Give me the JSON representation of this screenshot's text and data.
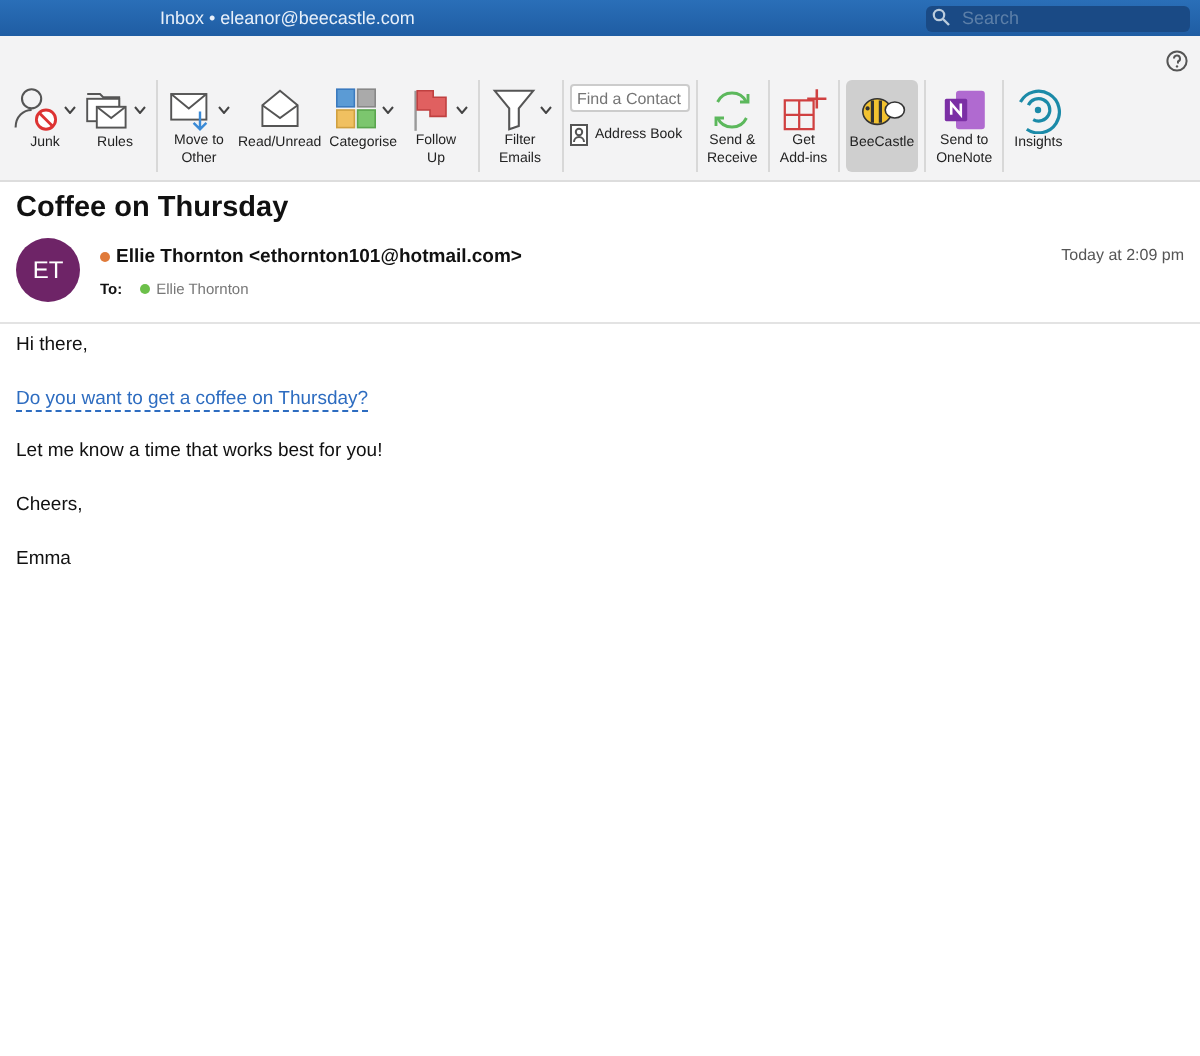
{
  "window": {
    "title": "Inbox • eleanor@beecastle.com",
    "search": {
      "placeholder": "Search"
    }
  },
  "ribbon": {
    "groups": [
      {
        "buttons": [
          {
            "label": "Junk",
            "dropdown": true,
            "selected": false
          },
          {
            "label": "Rules",
            "dropdown": true,
            "selected": false
          }
        ]
      },
      {
        "buttons": [
          {
            "label": "Move to\nOther",
            "dropdown": true,
            "selected": false
          },
          {
            "label": "Read/Unread",
            "dropdown": false,
            "selected": false
          },
          {
            "label": "Categorise",
            "dropdown": true,
            "selected": false
          },
          {
            "label": "Follow\nUp",
            "dropdown": true,
            "selected": false
          }
        ]
      },
      {
        "buttons": [
          {
            "label": "Filter\nEmails",
            "dropdown": true,
            "selected": false
          }
        ]
      },
      {
        "contact_search": {
          "placeholder": "Find a Contact",
          "address_book": "Address Book"
        }
      },
      {
        "buttons": [
          {
            "label": "Send &\nReceive",
            "dropdown": false,
            "selected": false
          }
        ]
      },
      {
        "buttons": [
          {
            "label": "Get\nAdd-ins",
            "dropdown": false,
            "selected": false
          }
        ]
      },
      {
        "buttons": [
          {
            "label": "BeeCastle",
            "dropdown": false,
            "selected": true
          }
        ]
      },
      {
        "buttons": [
          {
            "label": "Send to\nOneNote",
            "dropdown": false,
            "selected": false
          }
        ]
      },
      {
        "buttons": [
          {
            "label": "Insights",
            "dropdown": false,
            "selected": false
          }
        ]
      }
    ]
  },
  "message": {
    "subject": "Coffee on Thursday",
    "avatar": "ET",
    "sender": "Ellie Thornton <ethornton101@hotmail.com>",
    "sender_status": {
      "color": "#e07a3a"
    },
    "to_label": "To:",
    "recipient": "Ellie Thornton",
    "recipient_status": {
      "color": "#6cc04a"
    },
    "time": "Today at 2:09 pm",
    "body": [
      {
        "text": "Hi there,",
        "kind": "plain"
      },
      {
        "text": "Do you want to get a coffee on Thursday?",
        "kind": "link"
      },
      {
        "text": "Let me know a time that works best for you!",
        "kind": "plain"
      },
      {
        "text": "Cheers,",
        "kind": "plain"
      },
      {
        "text": "Emma",
        "kind": "plain"
      }
    ]
  }
}
